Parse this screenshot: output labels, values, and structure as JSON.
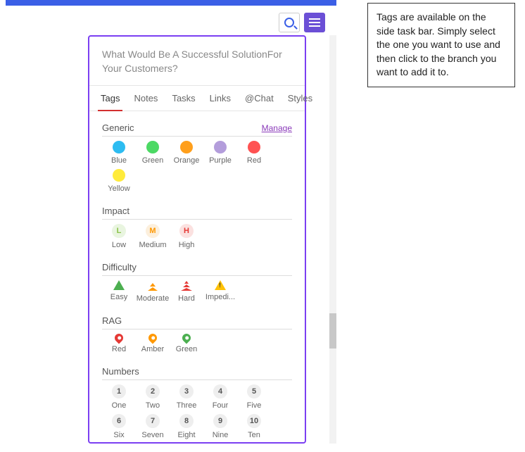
{
  "panel": {
    "title": "What Would Be A Successful SolutionFor Your Customers?"
  },
  "tabs": [
    "Tags",
    "Notes",
    "Tasks",
    "Links",
    "@Chat",
    "Styles"
  ],
  "manage_label": "Manage",
  "groups": {
    "generic": {
      "title": "Generic",
      "items": [
        {
          "label": "Blue",
          "color": "#2dbcf1"
        },
        {
          "label": "Green",
          "color": "#4cd964"
        },
        {
          "label": "Orange",
          "color": "#ff9f1c"
        },
        {
          "label": "Purple",
          "color": "#b39ddb"
        },
        {
          "label": "Red",
          "color": "#ff5252"
        },
        {
          "label": "Yellow",
          "color": "#ffeb3b"
        }
      ]
    },
    "impact": {
      "title": "Impact",
      "items": [
        {
          "letter": "L",
          "color": "#8bc34a",
          "back": "#e9f5e0",
          "label": "Low"
        },
        {
          "letter": "M",
          "color": "#ff9800",
          "back": "#fcefdc",
          "label": "Medium"
        },
        {
          "letter": "H",
          "color": "#e53935",
          "back": "#fbe1e0",
          "label": "High"
        }
      ]
    },
    "difficulty": {
      "title": "Difficulty",
      "items": [
        {
          "label": "Easy",
          "color": "#4caf50"
        },
        {
          "label": "Moderate",
          "color": "#ff9800"
        },
        {
          "label": "Hard",
          "color": "#e53935"
        },
        {
          "label": "Impedi...",
          "color": "#ffc107"
        }
      ]
    },
    "rag": {
      "title": "RAG",
      "items": [
        {
          "label": "Red",
          "color": "#e53935"
        },
        {
          "label": "Amber",
          "color": "#ff9800"
        },
        {
          "label": "Green",
          "color": "#4caf50"
        }
      ]
    },
    "numbers": {
      "title": "Numbers",
      "items": [
        {
          "num": "1",
          "label": "One"
        },
        {
          "num": "2",
          "label": "Two"
        },
        {
          "num": "3",
          "label": "Three"
        },
        {
          "num": "4",
          "label": "Four"
        },
        {
          "num": "5",
          "label": "Five"
        },
        {
          "num": "6",
          "label": "Six"
        },
        {
          "num": "7",
          "label": "Seven"
        },
        {
          "num": "8",
          "label": "Eight"
        },
        {
          "num": "9",
          "label": "Nine"
        },
        {
          "num": "10",
          "label": "Ten"
        }
      ]
    }
  },
  "callout": "Tags are available on the side task bar. Simply select the one you want to use and then click to the branch you want to add it to."
}
